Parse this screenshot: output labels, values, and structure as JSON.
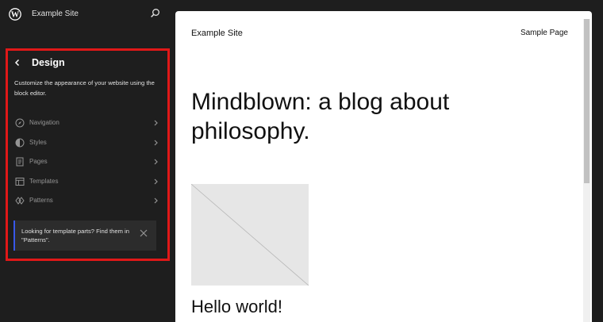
{
  "site": {
    "name": "Example Site"
  },
  "sidebar": {
    "title": "Design",
    "description": "Customize the appearance of your website using the block editor.",
    "items": [
      {
        "label": "Navigation",
        "icon": "navigation-icon"
      },
      {
        "label": "Styles",
        "icon": "styles-icon"
      },
      {
        "label": "Pages",
        "icon": "pages-icon"
      },
      {
        "label": "Templates",
        "icon": "templates-icon"
      },
      {
        "label": "Patterns",
        "icon": "patterns-icon"
      }
    ],
    "notice": "Looking for template parts? Find them in \"Patterns\"."
  },
  "canvas": {
    "site_title": "Example Site",
    "nav_link": "Sample Page",
    "heading": "Mindblown: a blog about philosophy.",
    "post_title": "Hello world!"
  },
  "colors": {
    "sidebar_bg": "#1e1e1e",
    "highlight_border": "#e01818",
    "notice_accent": "#3858e9"
  }
}
